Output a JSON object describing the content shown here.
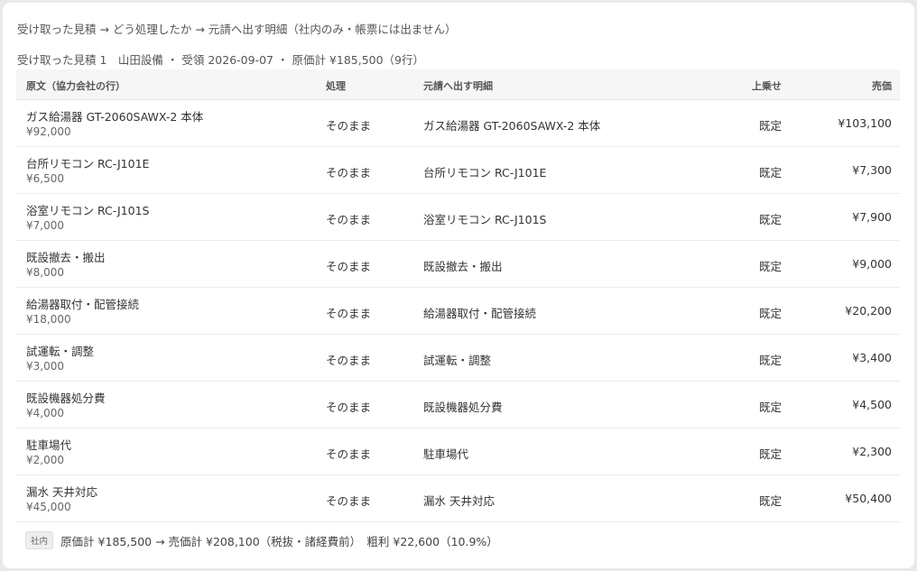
{
  "header": {
    "title": "受け取った見積 → どう処理したか → 元請へ出す明細（社内のみ・帳票には出ません）",
    "subtitle": "受け取った見積 1　山田設備 ・ 受領 2026-09-07 ・ 原価計 ¥185,500（9行）"
  },
  "table": {
    "columns": {
      "original": "原文（協力会社の行）",
      "process": "処理",
      "output": "元請へ出す明細",
      "markup": "上乗せ",
      "price": "売価"
    },
    "rows": [
      {
        "original": "ガス給湯器 GT-2060SAWX-2 本体",
        "original_price": "¥92,000",
        "process": "そのまま",
        "output": "ガス給湯器 GT-2060SAWX-2 本体",
        "markup": "既定",
        "price": "¥103,100"
      },
      {
        "original": "台所リモコン RC-J101E",
        "original_price": "¥6,500",
        "process": "そのまま",
        "output": "台所リモコン RC-J101E",
        "markup": "既定",
        "price": "¥7,300"
      },
      {
        "original": "浴室リモコン RC-J101S",
        "original_price": "¥7,000",
        "process": "そのまま",
        "output": "浴室リモコン RC-J101S",
        "markup": "既定",
        "price": "¥7,900"
      },
      {
        "original": "既設撤去・搬出",
        "original_price": "¥8,000",
        "process": "そのまま",
        "output": "既設撤去・搬出",
        "markup": "既定",
        "price": "¥9,000"
      },
      {
        "original": "給湯器取付・配管接続",
        "original_price": "¥18,000",
        "process": "そのまま",
        "output": "給湯器取付・配管接続",
        "markup": "既定",
        "price": "¥20,200"
      },
      {
        "original": "試運転・調整",
        "original_price": "¥3,000",
        "process": "そのまま",
        "output": "試運転・調整",
        "markup": "既定",
        "price": "¥3,400"
      },
      {
        "original": "既設機器処分費",
        "original_price": "¥4,000",
        "process": "そのまま",
        "output": "既設機器処分費",
        "markup": "既定",
        "price": "¥4,500"
      },
      {
        "original": "駐車場代",
        "original_price": "¥2,000",
        "process": "そのまま",
        "output": "駐車場代",
        "markup": "既定",
        "price": "¥2,300"
      },
      {
        "original": "漏水 天井対応",
        "original_price": "¥45,000",
        "process": "そのまま",
        "output": "漏水 天井対応",
        "markup": "既定",
        "price": "¥50,400"
      }
    ]
  },
  "footer": {
    "badge": "社内",
    "summary": "原価計 ¥185,500 → 売価計 ¥208,100（税抜・諸経費前）　粗利 ¥22,600（10.9%）"
  }
}
